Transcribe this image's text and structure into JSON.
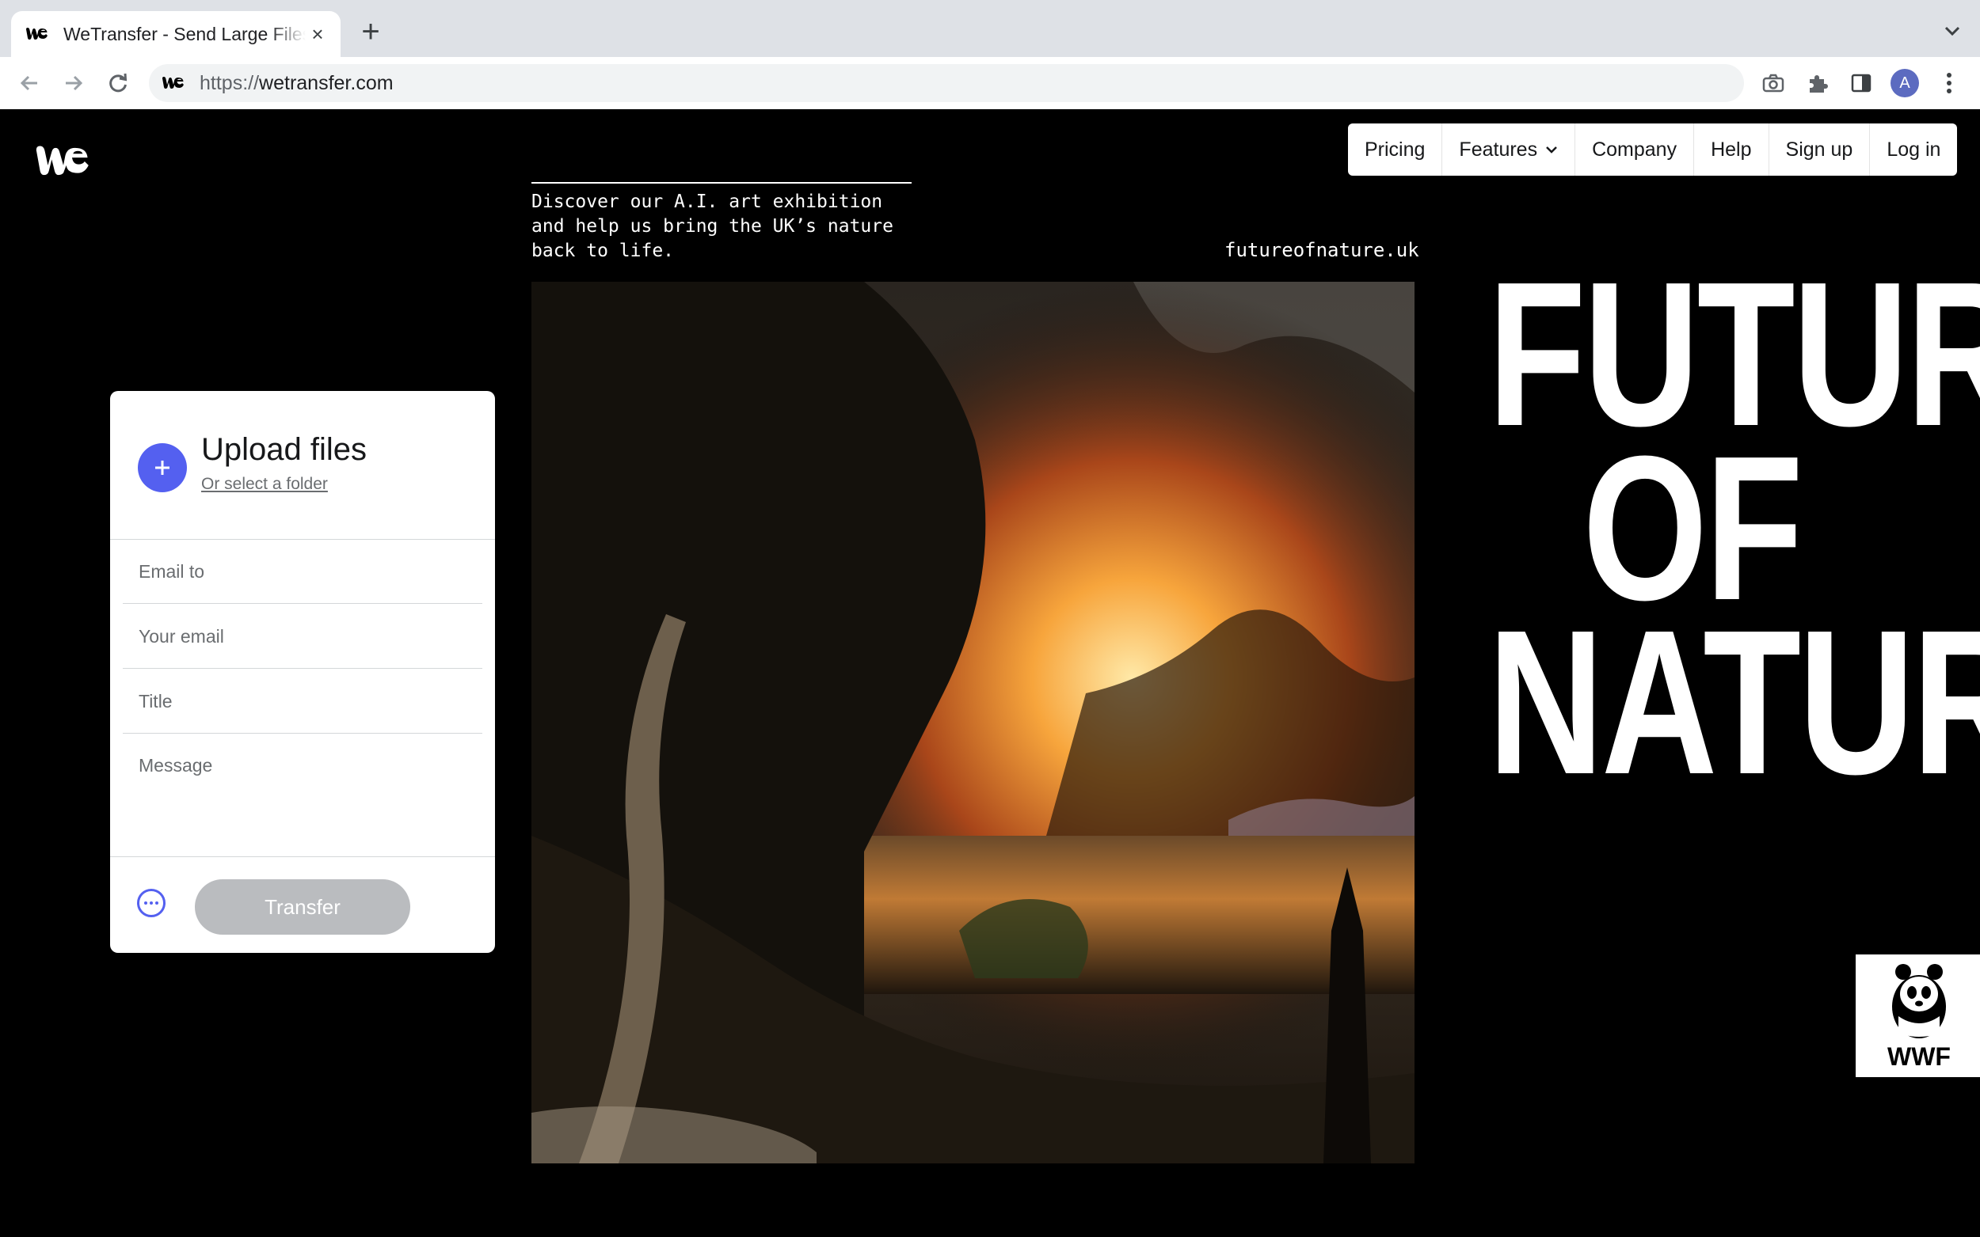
{
  "browser": {
    "tab_title": "WeTransfer - Send Large Files & Share Photos Online",
    "tab_close": "×",
    "new_tab": "+",
    "url_scheme": "https://",
    "url_host": "wetransfer.com",
    "profile_initial": "A"
  },
  "nav": {
    "items": [
      "Pricing",
      "Features",
      "Company",
      "Help",
      "Sign up",
      "Log in"
    ]
  },
  "promo": {
    "text": "Discover our A.I. art exhibition and help us bring the UK’s nature back to life.",
    "link": "futureofnature.uk",
    "headline": [
      "FUTURE",
      "OF",
      "NATURE"
    ],
    "partner_logo_text": "WWF"
  },
  "upload": {
    "title": "Upload files",
    "folder_link": "Or select a folder",
    "email_to_placeholder": "Email to",
    "your_email_placeholder": "Your email",
    "title_placeholder": "Title",
    "message_placeholder": "Message",
    "transfer_label": "Transfer"
  },
  "colors": {
    "accent": "#5460f0",
    "page_bg": "#000000",
    "button_disabled": "#babcbf"
  }
}
